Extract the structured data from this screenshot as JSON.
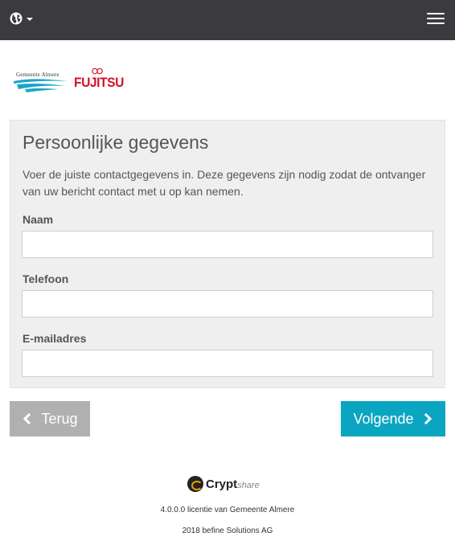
{
  "header": {
    "language_icon": "globe-icon",
    "menu_icon": "hamburger-menu-icon",
    "background_color": "#3a3a3f"
  },
  "logos": {
    "almere": "Gemeente Almere",
    "fujitsu": "FUJITSU"
  },
  "form": {
    "title": "Persoonlijke gegevens",
    "description": "Voer de juiste contactgegevens in. Deze gegevens zijn nodig zodat de ontvanger van uw bericht contact met u op kan nemen.",
    "fields": [
      {
        "label": "Naam",
        "value": ""
      },
      {
        "label": "Telefoon",
        "value": ""
      },
      {
        "label": "E-mailadres",
        "value": ""
      }
    ]
  },
  "buttons": {
    "back_label": "Terug",
    "next_label": "Volgende",
    "back_color": "#b0b0b0",
    "next_color": "#0aa5c0"
  },
  "footer": {
    "brand": "Crypt",
    "brand_suffix": "share",
    "license": "4.0.0.0 licentie van Gemeente Almere",
    "copyright": "2018 befine Solutions AG"
  }
}
